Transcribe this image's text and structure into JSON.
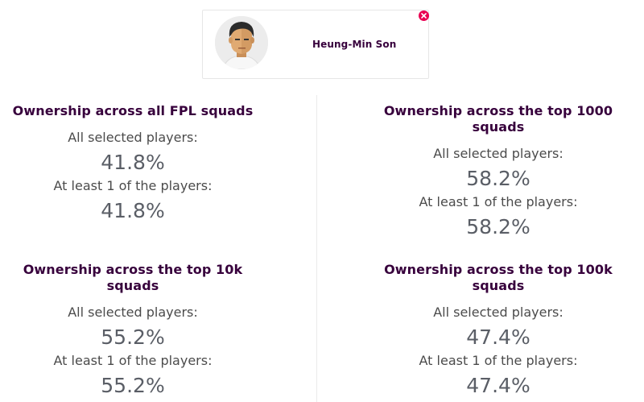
{
  "player": {
    "name": "Heung-Min Son",
    "avatar_icon": "player-avatar-icon",
    "remove_icon": "close-icon"
  },
  "colors": {
    "title": "#37003c",
    "remove": "#e90052",
    "value": "#5a5e66"
  },
  "stats": [
    {
      "title": "Ownership across all FPL squads",
      "all_label": "All selected players:",
      "all_value": "41.8%",
      "any_label": "At least 1 of the players:",
      "any_value": "41.8%"
    },
    {
      "title": "Ownership across the top 1000 squads",
      "all_label": "All selected players:",
      "all_value": "58.2%",
      "any_label": "At least 1 of the players:",
      "any_value": "58.2%"
    },
    {
      "title": "Ownership across the top 10k squads",
      "all_label": "All selected players:",
      "all_value": "55.2%",
      "any_label": "At least 1 of the players:",
      "any_value": "55.2%"
    },
    {
      "title": "Ownership across the top 100k squads",
      "all_label": "All selected players:",
      "all_value": "47.4%",
      "any_label": "At least 1 of the players:",
      "any_value": "47.4%"
    }
  ]
}
